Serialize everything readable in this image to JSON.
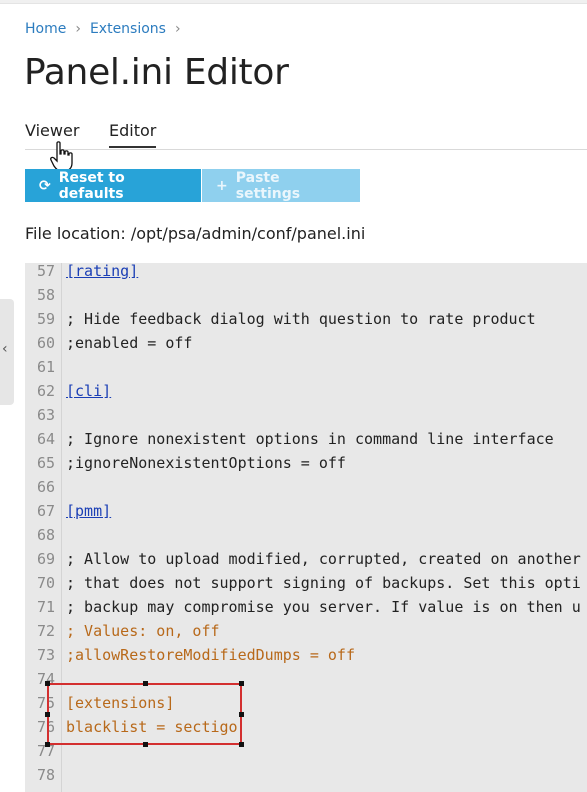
{
  "breadcrumb": {
    "home": "Home",
    "extensions": "Extensions"
  },
  "page": {
    "title": "Panel.ini Editor"
  },
  "tabs": [
    {
      "label": "Viewer"
    },
    {
      "label": "Editor"
    }
  ],
  "toolbar": {
    "reset_label": "Reset to defaults",
    "paste_label": "Paste settings"
  },
  "file_location": "File location: /opt/psa/admin/conf/panel.ini",
  "editor": {
    "lines": [
      {
        "n": "57",
        "text": "[rating]",
        "style": "link"
      },
      {
        "n": "58",
        "text": "",
        "style": ""
      },
      {
        "n": "59",
        "text": "; Hide feedback dialog with question to rate product",
        "style": ""
      },
      {
        "n": "60",
        "text": ";enabled = off",
        "style": ""
      },
      {
        "n": "61",
        "text": "",
        "style": ""
      },
      {
        "n": "62",
        "text": "[cli]",
        "style": "link"
      },
      {
        "n": "63",
        "text": "",
        "style": ""
      },
      {
        "n": "64",
        "text": "; Ignore nonexistent options in command line interface",
        "style": ""
      },
      {
        "n": "65",
        "text": ";ignoreNonexistentOptions = off",
        "style": ""
      },
      {
        "n": "66",
        "text": "",
        "style": ""
      },
      {
        "n": "67",
        "text": "[pmm]",
        "style": "link"
      },
      {
        "n": "68",
        "text": "",
        "style": ""
      },
      {
        "n": "69",
        "text": "; Allow to upload modified, corrupted, created on another",
        "style": ""
      },
      {
        "n": "70",
        "text": "; that does not support signing of backups. Set this opti",
        "style": ""
      },
      {
        "n": "71",
        "text": "; backup may compromise you server. If value is on then u",
        "style": ""
      },
      {
        "n": "72",
        "text": "; Values: on, off",
        "style": "orange"
      },
      {
        "n": "73",
        "text": ";allowRestoreModifiedDumps = off",
        "style": "orange"
      },
      {
        "n": "74",
        "text": "",
        "style": ""
      },
      {
        "n": "75",
        "text": "[extensions]",
        "style": "orange"
      },
      {
        "n": "76",
        "text": "blacklist = sectigo",
        "style": "orange"
      },
      {
        "n": "77",
        "text": "",
        "style": ""
      },
      {
        "n": "78",
        "text": "",
        "style": ""
      }
    ]
  },
  "icons": {
    "reset": "refresh-icon",
    "paste": "plus-icon",
    "collapse": "chevron-left-icon",
    "cursor": "hand-pointer-icon"
  },
  "colors": {
    "accent": "#28a3d8",
    "link": "#2c7cbf",
    "highlight_border": "#d32f2f",
    "changed_text": "#b8691a"
  }
}
